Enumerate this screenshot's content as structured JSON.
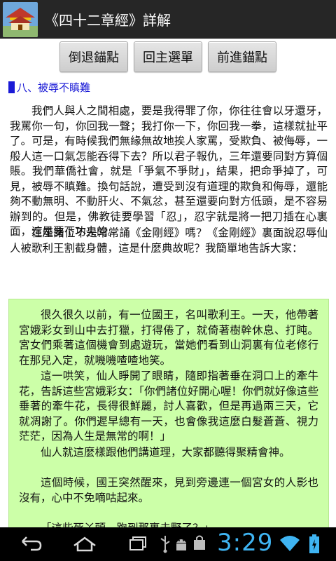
{
  "titlebar": {
    "title": "《四十二章經》詳解",
    "icon": "temple-icon"
  },
  "toolbar": {
    "back_anchor": "倒退錨點",
    "main_menu": "回主選單",
    "forward_anchor": "前進錨點"
  },
  "content": {
    "section_heading": "八、被辱不瞋難",
    "paragraphs": [
      "我們人與人之間相處，要是我得罪了你，你往往會以牙還牙，我罵你一句，你回我一聲；我打你一下，你回我一拳，這樣就扯平了。可是，有時候我們無緣無故地挨人家罵，受欺負、被侮辱，一般人這一口氣怎能吞得下去？所以君子報仇，三年還要同對方算個賬。我們華僑社會，就是「爭氣不爭財」，結果，把命爭掉了，可見，被辱不瞋難。換句話說，遭受到沒有道理的欺負和侮辱，還能夠不動無明、不動肝火、不氣忿，甚至還要向對方低頭，是不容易辦到的。但是，佛教徒要學習「忍」，忍字就是將一把刀插在心裏面，這是要下功夫的。",
      "在座諸位不是常常誦《金剛經》嗎？《金剛經》裏面說忍辱仙人被歌利王割截身體，這是什麼典故呢？我簡單地告訴大家："
    ],
    "story": [
      "很久很久以前，有一位國王，名叫歌利王。一天，他帶著宮娥彩女到山中去打獵，打得倦了，就倚著樹幹休息、打盹。宮女們乘著這個機會到處遊玩，當她們看到山洞裏有位老修行在那兒入定，就嘰嘰喳喳地笑。",
      "這一哄笑，仙人睜開了眼睛，隨即指著垂在洞口上的牽牛花，告訴這些宮娥彩女：「你們諸位好開心喔！你們就好像這些垂著的牽牛花，長得很鮮麗，討人喜歡，但是再過兩三天，它就凋謝了。你們遲早總有一天，也會像我這麼白髮蒼蒼、視力茫茫，因為人生是無常的啊！」",
      "仙人就這麼樣跟他們講道理，大家都聽得聚精會神。",
      "這個時候，國王突然醒來，見到旁邊連一個宮女的人影也沒有，心中不免嘀咕起來。",
      "「這些死丫頭，跑到那裏去野了？」"
    ]
  },
  "navbar": {
    "back_icon": "back-arrow-icon",
    "home_icon": "home-icon",
    "recent_icon": "recent-apps-icon",
    "usb_icon": "usb-icon",
    "android_icon": "android-debug-icon",
    "bag_icon": "shopping-bag-icon",
    "time": "3:29",
    "wifi_icon": "wifi-icon",
    "battery_icon": "battery-icon",
    "accent": "#3fb4f2"
  }
}
